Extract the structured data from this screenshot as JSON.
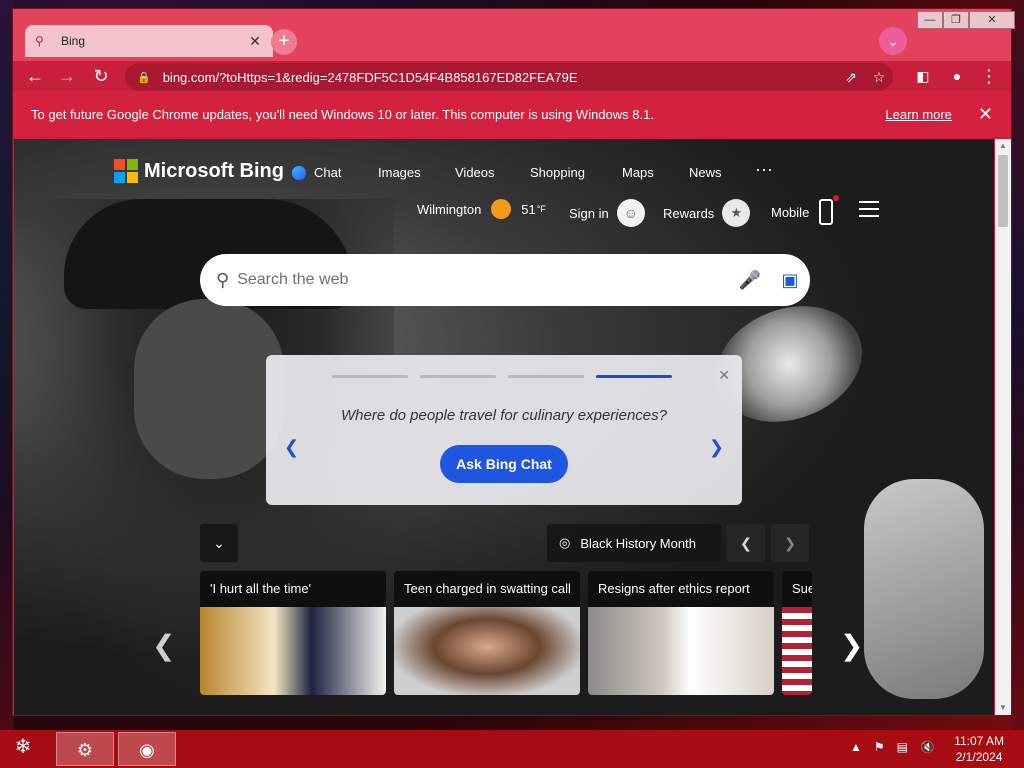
{
  "tab": {
    "title": "Bing",
    "favicon": "bing-search-icon"
  },
  "window_controls": {
    "minimize": "—",
    "restore": "❐",
    "close": "✕"
  },
  "toolbar": {
    "url": "bing.com/?toHttps=1&redig=2478FDF5C1D54F4B858167ED82FEA79E"
  },
  "infobar": {
    "message": "To get future Google Chrome updates, you'll need Windows 10 or later. This computer is using Windows 8.1.",
    "learn_more": "Learn more"
  },
  "bing": {
    "brand": "Microsoft Bing",
    "nav": [
      "Chat",
      "Images",
      "Videos",
      "Shopping",
      "Maps",
      "News"
    ],
    "more": "···",
    "location": "Wilmington",
    "temperature": "51",
    "temp_unit": "°F",
    "sign_in": "Sign in",
    "rewards": "Rewards",
    "mobile": "Mobile",
    "search_placeholder": "Search the web"
  },
  "prompt_card": {
    "question": "Where do people travel for culinary experiences?",
    "button": "Ask Bing Chat",
    "active_step": 4,
    "steps": 4
  },
  "topic": {
    "label": "Black History Month"
  },
  "news": [
    {
      "caption": "'I hurt all the time'"
    },
    {
      "caption": "Teen charged in swatting call"
    },
    {
      "caption": "Resigns after ethics report"
    },
    {
      "caption": "Sue"
    }
  ],
  "taskbar": {
    "time": "11:07 AM",
    "date": "2/1/2024"
  },
  "colors": {
    "chrome_frame": "#c8203c",
    "accent_blue": "#1f56e0",
    "taskbar": "#a70c12"
  }
}
